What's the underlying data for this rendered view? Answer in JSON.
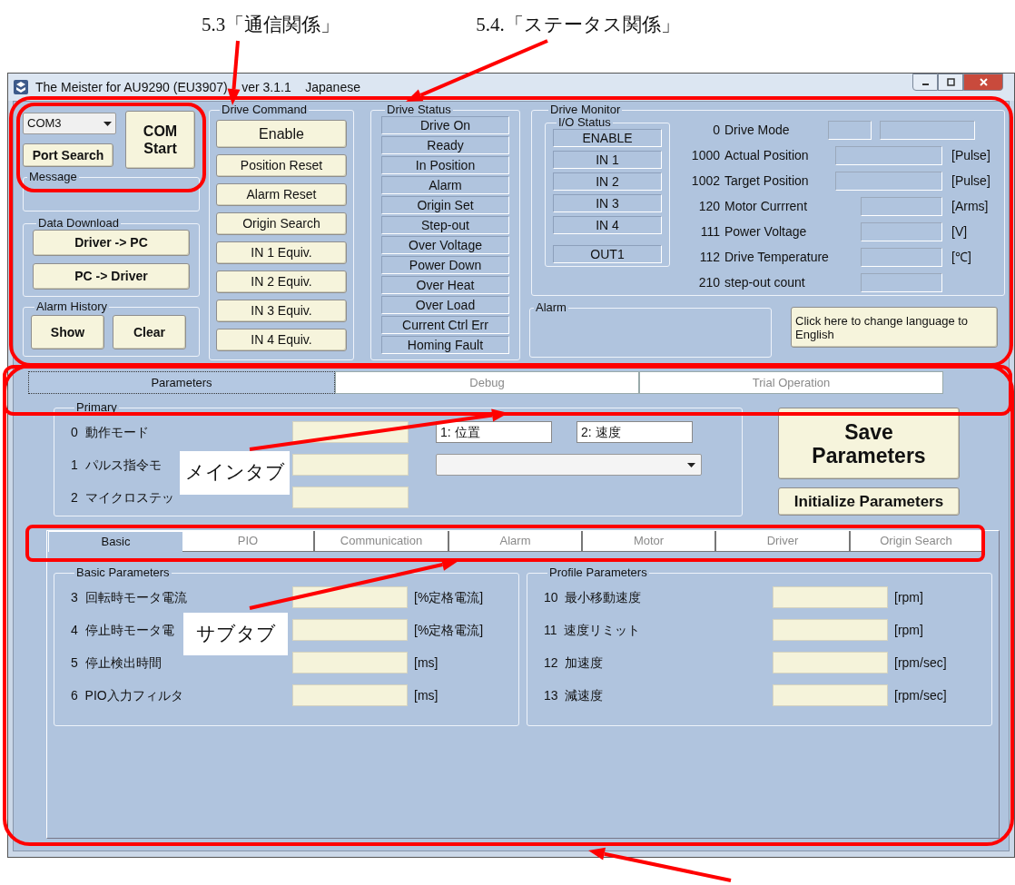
{
  "annotations": {
    "headings": [
      "5.3「通信関係」",
      "5.4.「ステータス関係」"
    ],
    "labels": [
      "メインタブ",
      "サブタブ"
    ]
  },
  "window": {
    "title": "The Meister for AU9290 (EU3907)    ver 3.1.1    Japanese"
  },
  "connection": {
    "port": "COM3",
    "port_search": "Port Search",
    "com_start": "COM Start"
  },
  "message": {
    "label": "Message"
  },
  "data_download": {
    "label": "Data Download",
    "buttons": [
      "Driver -> PC",
      "PC -> Driver"
    ]
  },
  "alarm_history": {
    "label": "Alarm History",
    "buttons": [
      "Show",
      "Clear"
    ]
  },
  "drive_command": {
    "label": "Drive Command",
    "buttons": [
      "Enable",
      "Position Reset",
      "Alarm Reset",
      "Origin Search",
      "IN 1 Equiv.",
      "IN 2 Equiv.",
      "IN 3 Equiv.",
      "IN 4 Equiv."
    ]
  },
  "drive_status": {
    "label": "Drive Status",
    "indicators": [
      "Drive On",
      "Ready",
      "In Position",
      "Alarm",
      "Origin Set",
      "Step-out",
      "Over Voltage",
      "Power Down",
      "Over Heat",
      "Over Load",
      "Current Ctrl Err",
      "Homing Fault"
    ]
  },
  "drive_monitor": {
    "label": "Drive Monitor",
    "io_status": {
      "label": "I/O Status",
      "inputs": [
        "ENABLE",
        "IN 1",
        "IN 2",
        "IN 3",
        "IN 4"
      ],
      "outputs": [
        "OUT1"
      ]
    },
    "rows": [
      {
        "number": "0",
        "name": "Drive Mode",
        "kind": "mode"
      },
      {
        "number": "1000",
        "name": "Actual Position",
        "kind": "wide",
        "unit": "[Pulse]"
      },
      {
        "number": "1002",
        "name": "Target Position",
        "kind": "wide",
        "unit": "[Pulse]"
      },
      {
        "number": "120",
        "name": "Motor Currrent",
        "kind": "narrow",
        "unit": "[Arms]"
      },
      {
        "number": "111",
        "name": "Power Voltage",
        "kind": "narrow",
        "unit": "[V]"
      },
      {
        "number": "112",
        "name": "Drive Temperature",
        "kind": "narrow",
        "unit": "[℃]"
      },
      {
        "number": "210",
        "name": "step-out count",
        "kind": "narrow"
      }
    ]
  },
  "alarm": {
    "label": "Alarm"
  },
  "language_button": "Click here to change language to English",
  "main_tabs": [
    {
      "label": "Parameters",
      "selected": true
    },
    {
      "label": "Debug",
      "selected": false
    },
    {
      "label": "Trial Operation",
      "selected": false
    }
  ],
  "primary": {
    "label": "Primary",
    "rows": [
      "0  動作モード",
      "1  パルス指令モ",
      "2  マイクロステッ"
    ],
    "mode_options": [
      "1: 位置",
      "2: 速度"
    ]
  },
  "save_button": "Save Parameters",
  "initialize_button": "Initialize Parameters",
  "sub_tabs": [
    {
      "label": "Basic",
      "selected": true
    },
    {
      "label": "PIO",
      "selected": false
    },
    {
      "label": "Communication",
      "selected": false
    },
    {
      "label": "Alarm",
      "selected": false
    },
    {
      "label": "Motor",
      "selected": false
    },
    {
      "label": "Driver",
      "selected": false
    },
    {
      "label": "Origin Search",
      "selected": false
    }
  ],
  "parameter_groups": [
    {
      "label": "Basic Parameters",
      "rows": [
        {
          "label": "3  回転時モータ電流",
          "unit": "[%定格電流]"
        },
        {
          "label": "4  停止時モータ電",
          "unit": "[%定格電流]"
        },
        {
          "label": "5  停止検出時間",
          "unit": "[ms]"
        },
        {
          "label": "6  PIO入力フィルタ",
          "unit": "[ms]"
        }
      ]
    },
    {
      "label": "Profile Parameters",
      "rows": [
        {
          "label": "10  最小移動速度",
          "unit": "[rpm]"
        },
        {
          "label": "11  速度リミット",
          "unit": "[rpm]"
        },
        {
          "label": "12  加速度",
          "unit": "[rpm/sec]"
        },
        {
          "label": "13  減速度",
          "unit": "[rpm/sec]"
        }
      ]
    }
  ]
}
